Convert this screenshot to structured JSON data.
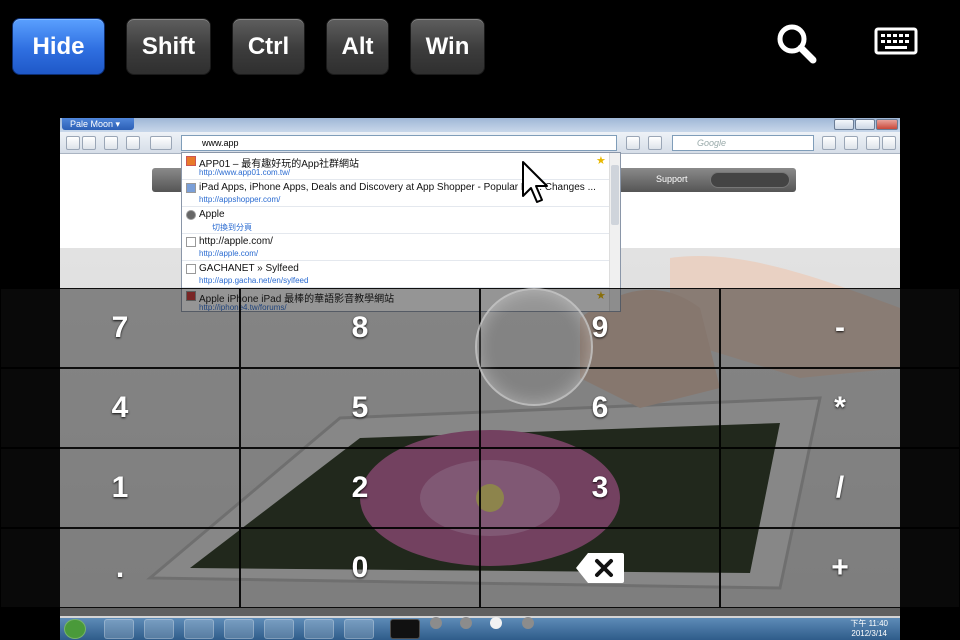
{
  "toolbar": {
    "modifier_keys": [
      {
        "label": "Hide",
        "active": true
      },
      {
        "label": "Shift",
        "active": false
      },
      {
        "label": "Ctrl",
        "active": false
      },
      {
        "label": "Alt",
        "active": false
      },
      {
        "label": "Win",
        "active": false
      }
    ],
    "icons": [
      "search-icon",
      "keyboard-icon"
    ]
  },
  "remote_screen": {
    "browser": {
      "app_menu": "Pale Moon",
      "url_value": "www.app",
      "search_placeholder": "Google",
      "site_nav_link": "Support"
    },
    "autocomplete": [
      {
        "title": "APP01 – 最有趣好玩的App社群網站",
        "url": "http://www.app01.com.tw/",
        "starred": true
      },
      {
        "title": "iPad Apps, iPhone Apps, Deals and Discovery at App Shopper - Popular Re... Changes ...",
        "url": "http://appshopper.com/",
        "starred": false
      },
      {
        "title": "Apple",
        "url": "切換到分頁",
        "starred": false
      },
      {
        "title": "http://apple.com/",
        "url": "http://apple.com/",
        "starred": false
      },
      {
        "title": "GACHANET » Sylfeed",
        "url": "http://app.gacha.net/en/sylfeed",
        "starred": false
      },
      {
        "title": "Apple iPhone iPad 最棒的華語影音教學網站",
        "url": "http://iphone4.tw/forums/",
        "starred": true
      }
    ],
    "taskbar": {
      "clock_line1": "下午 11:40",
      "clock_line2": "2012/3/14"
    }
  },
  "keypad": {
    "rows": [
      [
        "7",
        "8",
        "9",
        "-"
      ],
      [
        "4",
        "5",
        "6",
        "*"
      ],
      [
        "1",
        "2",
        "3",
        "/"
      ],
      [
        ".",
        "0",
        "backspace",
        "+"
      ]
    ]
  },
  "pager": {
    "count": 4,
    "current_index": 2
  },
  "colors": {
    "active_button": "#2f6fe0",
    "button": "#3c3c3c",
    "background": "#000000"
  }
}
